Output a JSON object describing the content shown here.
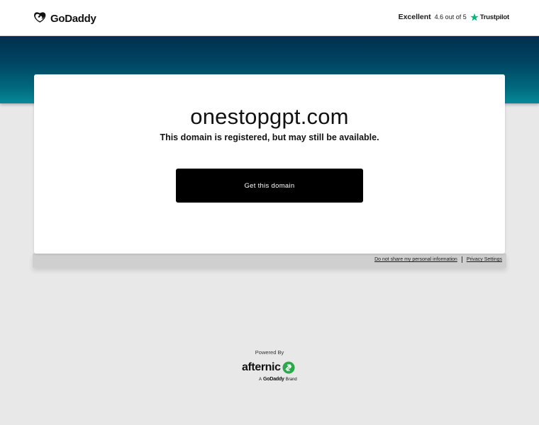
{
  "header": {
    "logo_text": "GoDaddy",
    "trust_rating": "Excellent",
    "trust_score": "4.6 out of 5",
    "trust_brand": "Trustpilot",
    "trust_star_color": "#00b67a"
  },
  "main": {
    "domain": "onestopgpt.com",
    "subtitle": "This domain is registered, but may still be available.",
    "cta_label": "Get this domain"
  },
  "footer_links": {
    "do_not_share": "Do not share my personal information",
    "privacy": "Privacy Settings"
  },
  "powered": {
    "label": "Powered By",
    "brand": "afternic",
    "brand_prefix": "A",
    "brand_parent": "GoDaddy",
    "brand_suffix": "Brand",
    "brand_color": "#2ba84a"
  },
  "colors": {
    "band_top": "#00304e",
    "band_bottom": "#078998",
    "cta_background": "#000000"
  }
}
